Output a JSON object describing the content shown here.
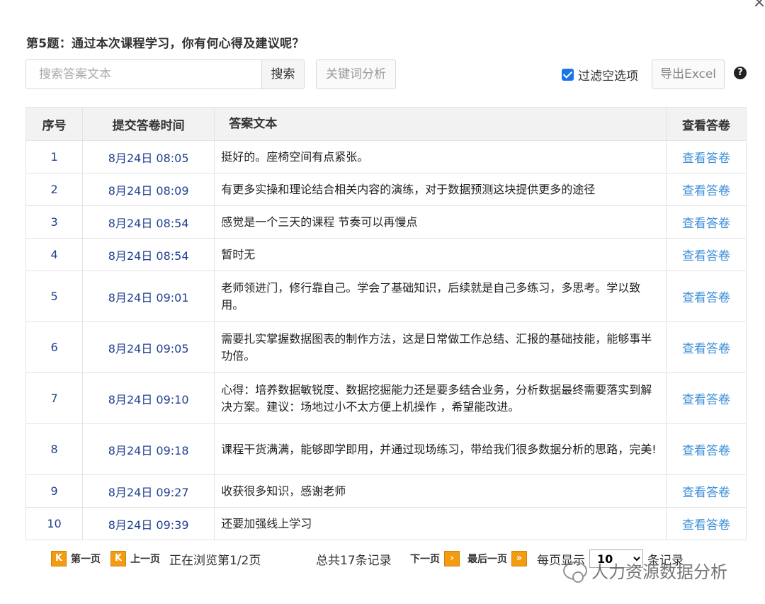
{
  "dialog": {
    "close_glyph": "×",
    "question": "第5题：通过本次课程学习，你有何心得及建议呢？"
  },
  "toolbar": {
    "search_placeholder": "搜索答案文本",
    "search_label": "搜索",
    "keyword_label": "关键词分析",
    "filter_label": "过滤空选项",
    "filter_checked": true,
    "export_label": "导出Excel",
    "help_glyph": "?"
  },
  "table": {
    "headers": [
      "序号",
      "提交答卷时间",
      "答案文本",
      "查看答卷"
    ],
    "rows": [
      {
        "idx": "1",
        "time": "8月24日 08:05",
        "answer": "挺好的。座椅空间有点紧张。",
        "link": "查看答卷"
      },
      {
        "idx": "2",
        "time": "8月24日 08:09",
        "answer": "有更多实操和理论结合相关内容的演练，对于数据预测这块提供更多的途径",
        "link": "查看答卷"
      },
      {
        "idx": "3",
        "time": "8月24日 08:54",
        "answer": "感觉是一个三天的课程 节奏可以再慢点",
        "link": "查看答卷"
      },
      {
        "idx": "4",
        "time": "8月24日 08:54",
        "answer": "暂时无",
        "link": "查看答卷"
      },
      {
        "idx": "5",
        "time": "8月24日 09:01",
        "answer": "老师领进门，修行靠自己。学会了基础知识，后续就是自己多练习，多思考。学以致用。",
        "link": "查看答卷"
      },
      {
        "idx": "6",
        "time": "8月24日 09:05",
        "answer": "需要扎实掌握数据图表的制作方法，这是日常做工作总结、汇报的基础技能，能够事半功倍。",
        "link": "查看答卷"
      },
      {
        "idx": "7",
        "time": "8月24日 09:10",
        "answer": "心得：培养数据敏锐度、数据挖掘能力还是要多结合业务，分析数据最终需要落实到解决方案。建议：场地过小不太方便上机操作 ，希望能改进。",
        "link": "查看答卷"
      },
      {
        "idx": "8",
        "time": "8月24日 09:18",
        "answer": "课程干货满满，能够即学即用，并通过现场练习，带给我们很多数据分析的思路，完美!",
        "link": "查看答卷"
      },
      {
        "idx": "9",
        "time": "8月24日 09:27",
        "answer": "收获很多知识，感谢老师",
        "link": "查看答卷"
      },
      {
        "idx": "10",
        "time": "8月24日 09:39",
        "answer": "还要加强线上学习",
        "link": "查看答卷"
      }
    ]
  },
  "pager": {
    "first_glyph": "K",
    "first_label": "第一页",
    "prev_glyph": "K",
    "prev_label": "上一页",
    "status": "正在浏览第1/2页",
    "total": "总共17条记录",
    "next_label": "下一页",
    "next_glyph": "›",
    "last_label": "最后一页",
    "last_glyph": "»",
    "per_page_label": "每页显示",
    "per_page_value": "10",
    "records_suffix": "条记录"
  },
  "watermark": {
    "text": "人力资源数据分析"
  },
  "colors": {
    "checkbox": "#1a73e8",
    "link": "#3d8fd8",
    "index_text": "#1f3f8f",
    "pager_icon": "#f39c12",
    "header_bg": "#f2f2f2"
  }
}
